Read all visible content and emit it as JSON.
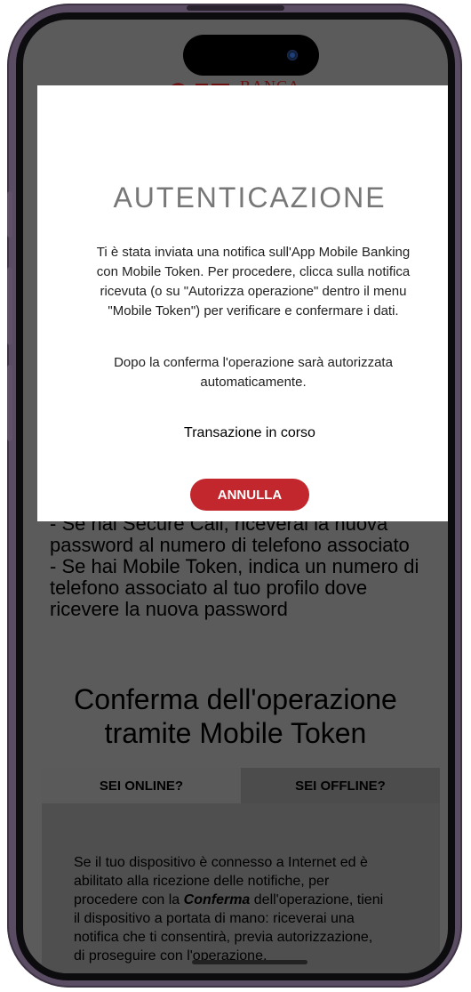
{
  "logo": {
    "text": "BANCA"
  },
  "modal": {
    "title": "AUTENTICAZIONE",
    "paragraph1": [
      "Ti è stata inviata una notifica sull'App Mobile Banking",
      "con Mobile Token. Per procedere, clicca sulla notifica",
      "ricevuta (o su \"Autorizza operazione\" dentro il menu",
      "\"Mobile Token\") per verificare e confermare i dati."
    ],
    "paragraph2": [
      "Dopo la conferma l'operazione sarà autorizzata",
      "automaticamente."
    ],
    "status": "Transazione in corso",
    "cancel_label": "ANNULLA"
  },
  "background": {
    "text_lines": [
      "- Se hai Secure Call, riceverai la nuova",
      "password al numero di telefono associato",
      "- Se hai Mobile Token, indica un numero di",
      "telefono associato al tuo profilo dove",
      "ricevere la nuova password"
    ],
    "section_title": [
      "Conferma dell'operazione",
      "tramite Mobile Token"
    ],
    "tabs": [
      {
        "label": "SEI ONLINE?",
        "active": true
      },
      {
        "label": "SEI OFFLINE?",
        "active": false
      }
    ],
    "panel": {
      "line1": "Se il tuo dispositivo è connesso a Internet ed è",
      "line2": "abilitato alla ricezione delle notifiche, per",
      "line3_pre": "procedere con la ",
      "line3_em": "Conferma",
      "line3_post": " dell'operazione, tieni",
      "line4": "il dispositivo a portata di mano: riceverai una",
      "line5": "notifica che ti consentirà, previa autorizzazione,",
      "line6": "di proseguire con l'operazione."
    }
  },
  "colors": {
    "accent": "#c1272d",
    "overlay": "#5b5b5b",
    "frame": "#5a4d63"
  }
}
